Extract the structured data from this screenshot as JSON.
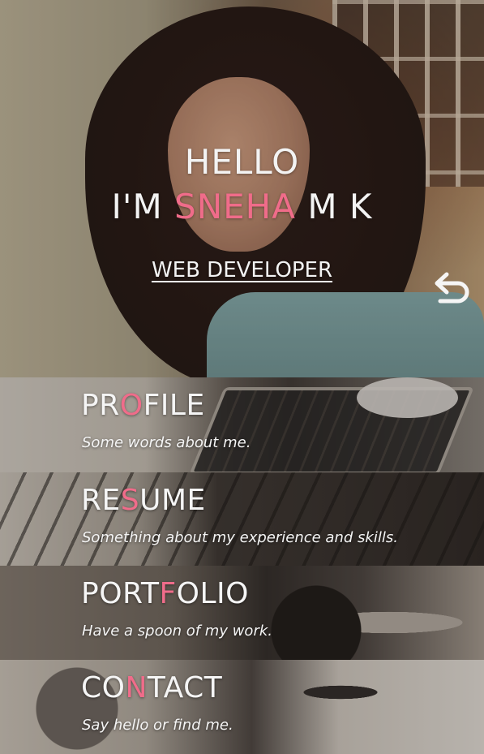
{
  "hero": {
    "greeting": "HELLO",
    "name_prefix": "I'M ",
    "name_highlight": "SNEHA",
    "name_suffix": " M K",
    "role": "WEB DEVELOPER",
    "back_icon": "undo-arrow-icon"
  },
  "menu": [
    {
      "id": "profile",
      "title_a": "PR",
      "title_accent": "O",
      "title_b": "FILE",
      "subtitle": "Some words about me."
    },
    {
      "id": "resume",
      "title_a": "RE",
      "title_accent": "S",
      "title_b": "UME",
      "subtitle": "Something about my experience and skills."
    },
    {
      "id": "portfolio",
      "title_a": "PORT",
      "title_accent": "F",
      "title_b": "OLIO",
      "subtitle": "Have a spoon of my work."
    },
    {
      "id": "contact",
      "title_a": "CO",
      "title_accent": "N",
      "title_b": "TACT",
      "subtitle": "Say hello or find me."
    }
  ],
  "colors": {
    "accent": "#f06c8a",
    "text": "#f3f3f3"
  }
}
